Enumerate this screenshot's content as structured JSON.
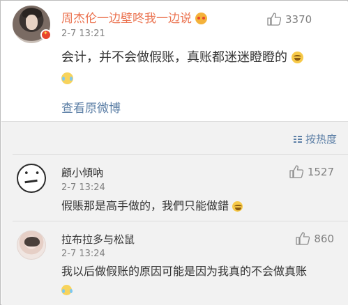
{
  "post": {
    "author": "周杰伦一边壁咚我一边说",
    "author_emoji": "heart-eyes-icon",
    "time": "2-7 13:21",
    "likes": "3370",
    "text": "会计，并不会做假账，真账都迷迷瞪瞪的",
    "view_original": "查看原微博"
  },
  "sort": {
    "label": "按热度"
  },
  "comments": [
    {
      "name": "顧小傾吶",
      "time": "2-7 13:24",
      "likes": "1527",
      "text": "假賬那是高手做的，我們只能做錯"
    },
    {
      "name": "拉布拉多与松鼠",
      "time": "2-7 13:24",
      "likes": "860",
      "text": "我以后做假账的原因可能是因为我真的不会做真账"
    }
  ],
  "colors": {
    "name_orange": "#eb7350",
    "link_blue": "#5c7fa6",
    "muted_gray": "#808080",
    "comments_bg": "#f2f2f2"
  }
}
